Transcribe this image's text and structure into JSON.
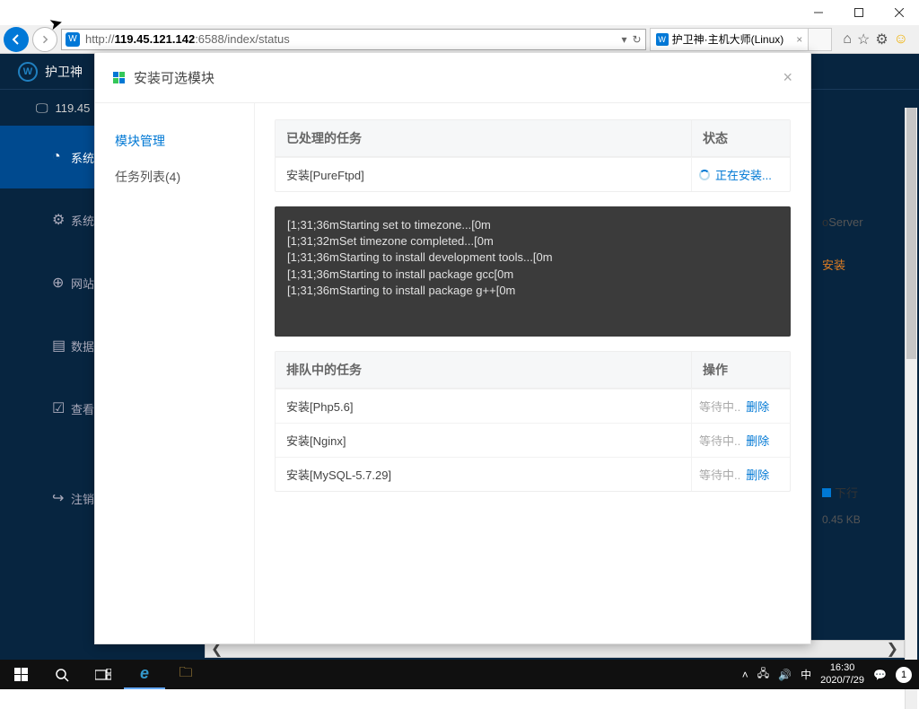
{
  "window": {
    "min": "—",
    "max": "☐",
    "close": "✕"
  },
  "browser": {
    "url_prefix": "http://",
    "url_host": "119.45.121.142",
    "url_suffix": ":6588/index/status",
    "tab_title": "护卫神·主机大师(Linux)",
    "tab_close": "×"
  },
  "ie_icons": {
    "home": "⌂",
    "star": "☆",
    "gear": "⚙",
    "smile": "☺"
  },
  "app": {
    "brand": "护卫神",
    "ip_label": "119.45",
    "side": [
      "系统",
      "系统",
      "网站",
      "数据",
      "查看",
      "注销"
    ]
  },
  "bg": {
    "server_label": "Server",
    "install_label": "安装",
    "net_label": "下行",
    "net_value": "0.45 KB",
    "scroll_left": "❮",
    "scroll_right": "❯"
  },
  "modal": {
    "title": "安装可选模块",
    "close": "×",
    "sidebar": [
      {
        "label": "模块管理",
        "active": true
      },
      {
        "label": "任务列表(4)",
        "active": false
      }
    ],
    "processed": {
      "h1": "已处理的任务",
      "h2": "状态",
      "rows": [
        {
          "name": "安装[PureFtpd]",
          "status": "正在安装...",
          "installing": true
        }
      ]
    },
    "console_lines": [
      "[1;31;36mStarting set to timezone...[0m",
      "[1;31;32mSet timezone completed...[0m",
      "[1;31;36mStarting to install development tools...[0m",
      "[1;31;36mStarting to install package gcc[0m",
      "[1;31;36mStarting to install package g++[0m"
    ],
    "queued": {
      "h1": "排队中的任务",
      "h2": "操作",
      "rows": [
        {
          "name": "安装[Php5.6]",
          "wait": "等待中..",
          "del": "删除"
        },
        {
          "name": "安装[Nginx]",
          "wait": "等待中..",
          "del": "删除"
        },
        {
          "name": "安装[MySQL-5.7.29]",
          "wait": "等待中..",
          "del": "删除"
        }
      ]
    }
  },
  "taskbar": {
    "ime": "中",
    "time": "16:30",
    "date": "2020/7/29",
    "badge": "1"
  }
}
